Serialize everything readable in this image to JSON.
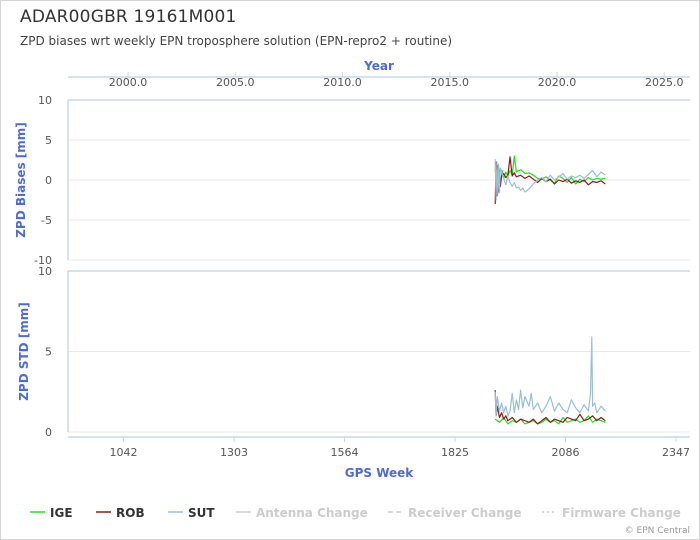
{
  "header": {
    "title": "ADAR00GBR 19161M001",
    "subtitle": "ZPD biases wrt weekly EPN troposphere solution (EPN-repro2 + routine)"
  },
  "chart_data": {
    "type": "line",
    "top_axis": {
      "label": "Year",
      "ticks": [
        "2000.0",
        "2005.0",
        "2010.0",
        "2015.0",
        "2020.0",
        "2025.0"
      ],
      "year_range": [
        1997.2,
        2026.2
      ]
    },
    "x": {
      "label": "GPS Week",
      "ticks": [
        1042,
        1303,
        1564,
        1825,
        2086,
        2347
      ],
      "range": [
        911,
        2380
      ]
    },
    "panels": [
      {
        "id": "bias",
        "ylabel": "ZPD Biases [mm]",
        "ylim": [
          -10,
          10
        ],
        "yticks": [
          10,
          5,
          0,
          -5,
          -10
        ],
        "series": [
          {
            "name": "IGE",
            "color": "#22dd22",
            "x": [
              1920,
              1924,
              1928,
              1932,
              1936,
              1940,
              1945,
              1950,
              1955,
              1960,
              1965,
              1970,
              1980,
              1990,
              2000,
              2010,
              2020,
              2030,
              2040,
              2050,
              2060,
              2070,
              2080,
              2090,
              2100,
              2110,
              2120,
              2130,
              2140,
              2150,
              2160,
              2170,
              2180
            ],
            "y": [
              1.4,
              -1.2,
              1.6,
              -0.8,
              1.2,
              0.2,
              1.0,
              0.5,
              1.2,
              0.6,
              3.0,
              1.0,
              1.3,
              0.8,
              0.9,
              0.6,
              0.2,
              0.1,
              0.4,
              0.0,
              -0.4,
              0.5,
              0.2,
              -0.3,
              0.3,
              -0.5,
              0.1,
              -0.2,
              0.3,
              0.0,
              0.2,
              0.1,
              0.2
            ]
          },
          {
            "name": "ROB",
            "color": "#8b1a1a",
            "x": [
              1920,
              1922,
              1924,
              1926,
              1928,
              1930,
              1932,
              1935,
              1940,
              1945,
              1950,
              1955,
              1960,
              1965,
              1970,
              1980,
              1990,
              2000,
              2010,
              2020,
              2030,
              2040,
              2050,
              2060,
              2070,
              2080,
              2090,
              2100,
              2110,
              2120,
              2130,
              2140,
              2150,
              2160,
              2170,
              2180
            ],
            "y": [
              -3.0,
              2.2,
              -2.0,
              1.8,
              -1.5,
              1.2,
              -0.8,
              0.5,
              0.8,
              0.3,
              0.6,
              2.9,
              0.5,
              0.9,
              0.4,
              0.6,
              0.2,
              0.5,
              0.1,
              -0.3,
              0.2,
              -0.2,
              0.1,
              -0.5,
              0.0,
              -0.2,
              0.1,
              -0.4,
              -0.1,
              -0.3,
              0.0,
              -0.6,
              -0.2,
              -0.3,
              -0.1,
              -0.5
            ]
          },
          {
            "name": "SUT",
            "color": "#9bbdd6",
            "x": [
              1920,
              1922,
              1924,
              1926,
              1928,
              1930,
              1932,
              1935,
              1940,
              1945,
              1950,
              1955,
              1960,
              1965,
              1970,
              1975,
              1980,
              1985,
              1990,
              2000,
              2010,
              2020,
              2030,
              2040,
              2050,
              2060,
              2070,
              2080,
              2090,
              2100,
              2110,
              2120,
              2130,
              2140,
              2150,
              2160,
              2170,
              2180
            ],
            "y": [
              2.6,
              -2.5,
              2.3,
              -1.8,
              2.0,
              -1.6,
              1.5,
              1.0,
              0.2,
              -0.6,
              0.5,
              -0.3,
              -0.8,
              -0.3,
              -1.0,
              -0.9,
              -1.3,
              -1.0,
              -1.5,
              -1.1,
              -0.5,
              0.0,
              0.3,
              -0.2,
              0.6,
              0.0,
              0.4,
              0.8,
              0.1,
              0.5,
              0.3,
              0.6,
              0.2,
              0.7,
              1.2,
              0.4,
              1.0,
              0.6
            ]
          }
        ]
      },
      {
        "id": "std",
        "ylabel": "ZPD STD [mm]",
        "ylim": [
          0,
          10
        ],
        "yticks": [
          10,
          5,
          0
        ],
        "series": [
          {
            "name": "IGE",
            "color": "#22dd22",
            "x": [
              1920,
              1930,
              1940,
              1950,
              1960,
              1970,
              1980,
              1990,
              2000,
              2010,
              2020,
              2030,
              2040,
              2050,
              2060,
              2070,
              2080,
              2090,
              2100,
              2110,
              2120,
              2130,
              2140,
              2150,
              2160,
              2170,
              2180
            ],
            "y": [
              0.8,
              0.6,
              0.9,
              0.5,
              0.7,
              0.6,
              0.8,
              0.5,
              0.6,
              0.7,
              0.5,
              0.6,
              0.8,
              0.6,
              0.7,
              0.5,
              0.9,
              0.6,
              0.7,
              0.8,
              0.6,
              0.7,
              1.0,
              0.6,
              0.8,
              0.7,
              0.6
            ]
          },
          {
            "name": "ROB",
            "color": "#8b1a1a",
            "x": [
              1920,
              1922,
              1925,
              1930,
              1935,
              1940,
              1945,
              1950,
              1960,
              1970,
              1980,
              1990,
              2000,
              2010,
              2020,
              2030,
              2040,
              2050,
              2060,
              2070,
              2080,
              2090,
              2100,
              2110,
              2120,
              2130,
              2140,
              2150,
              2160,
              2170,
              2180
            ],
            "y": [
              2.6,
              1.0,
              1.6,
              0.9,
              1.2,
              0.8,
              1.0,
              0.7,
              0.9,
              0.6,
              0.8,
              0.7,
              0.6,
              0.8,
              0.5,
              0.7,
              0.9,
              0.6,
              0.8,
              0.7,
              0.6,
              0.9,
              0.8,
              0.7,
              1.1,
              0.7,
              0.8,
              1.0,
              0.7,
              0.9,
              0.7
            ]
          },
          {
            "name": "SUT",
            "color": "#9bbdd6",
            "x": [
              1920,
              1922,
              1925,
              1930,
              1935,
              1940,
              1945,
              1950,
              1955,
              1960,
              1965,
              1970,
              1975,
              1980,
              1985,
              1990,
              2000,
              2005,
              2010,
              2020,
              2030,
              2040,
              2050,
              2060,
              2070,
              2080,
              2090,
              2100,
              2110,
              2120,
              2130,
              2140,
              2145,
              2148,
              2150,
              2155,
              2160,
              2170,
              2180
            ],
            "y": [
              2.5,
              1.0,
              2.2,
              1.3,
              1.8,
              1.2,
              1.6,
              1.0,
              1.3,
              2.4,
              1.2,
              2.0,
              1.4,
              2.6,
              1.5,
              2.2,
              1.6,
              2.4,
              1.4,
              1.8,
              1.2,
              1.6,
              2.2,
              1.3,
              1.8,
              1.4,
              1.2,
              2.0,
              1.5,
              1.2,
              1.7,
              1.3,
              2.4,
              5.9,
              1.6,
              1.8,
              1.2,
              1.6,
              1.3
            ]
          }
        ]
      }
    ],
    "legend": {
      "placement": "bottom",
      "items": [
        {
          "label": "IGE",
          "color": "#22dd22",
          "style": "solid",
          "active": true
        },
        {
          "label": "ROB",
          "color": "#8b1a1a",
          "style": "solid",
          "active": true
        },
        {
          "label": "SUT",
          "color": "#9bbdd6",
          "style": "solid",
          "active": true
        },
        {
          "label": "Antenna Change",
          "color": "#cccccc",
          "style": "solid",
          "active": false
        },
        {
          "label": "Receiver Change",
          "color": "#cccccc",
          "style": "dashed",
          "active": false
        },
        {
          "label": "Firmware Change",
          "color": "#cccccc",
          "style": "dotted",
          "active": false
        }
      ]
    },
    "colors": {
      "axis_label": "#4f6bd0",
      "axis_line": "#c9d8e6",
      "grid": "#e8e8e8",
      "inactive_legend": "#cccccc"
    }
  },
  "footer": {
    "credit": "© EPN Central"
  }
}
